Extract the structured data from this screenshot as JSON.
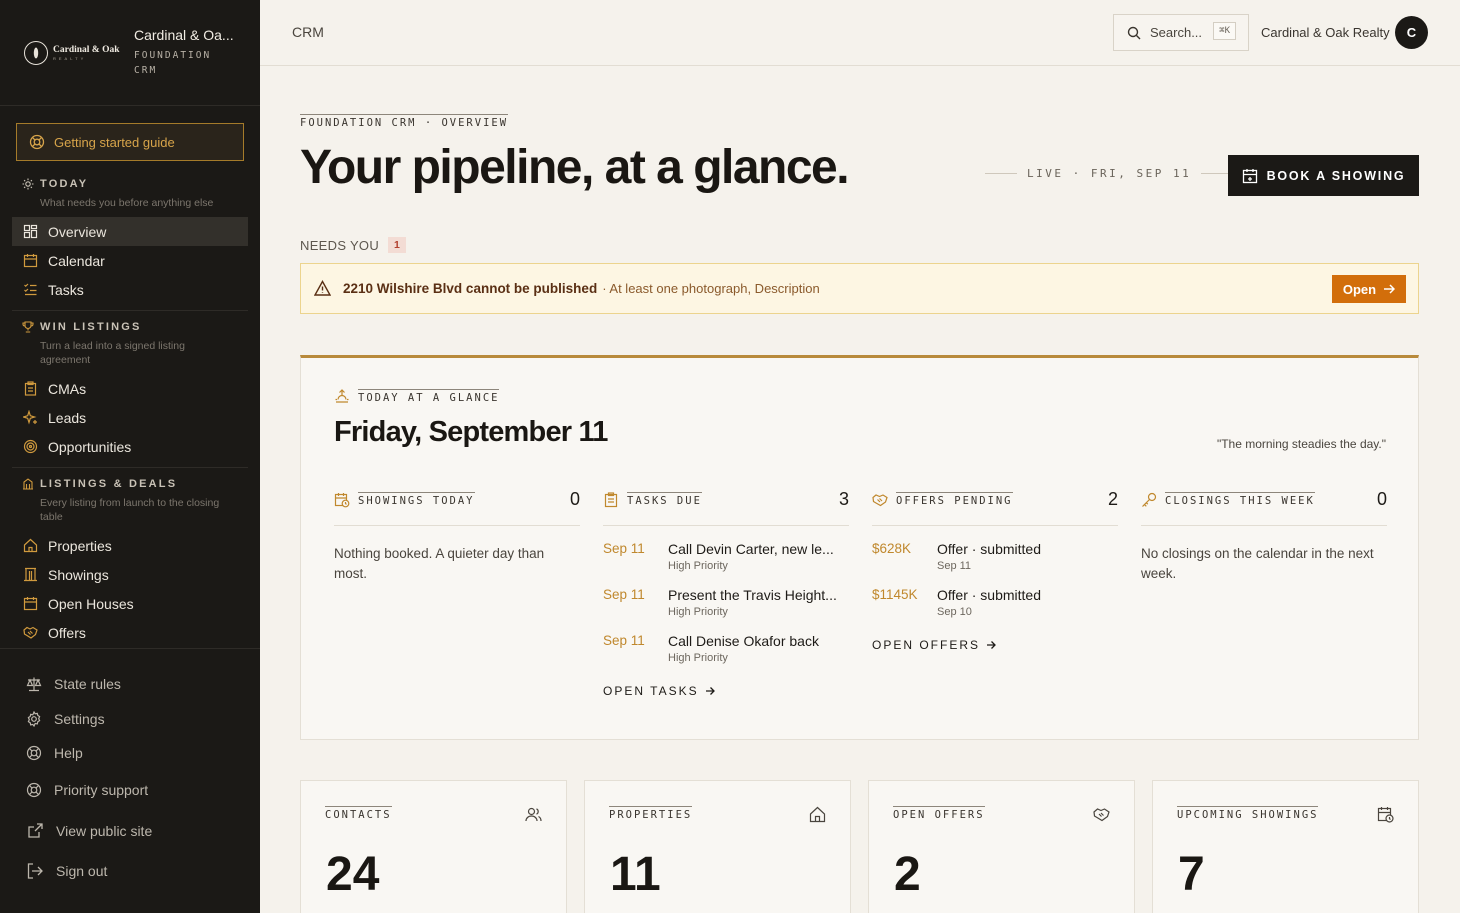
{
  "brand": {
    "logo_text": "Cardinal & Oak",
    "logo_sub": "REALTY",
    "name": "Cardinal & Oa...",
    "sub_line1": "FOUNDATION",
    "sub_line2": "CRM"
  },
  "sidebar": {
    "guide_label": "Getting started guide",
    "sections": [
      {
        "title": "TODAY",
        "desc": "What needs you before anything else",
        "items": [
          {
            "label": "Overview",
            "icon": "overview-icon"
          },
          {
            "label": "Calendar",
            "icon": "calendar-icon"
          },
          {
            "label": "Tasks",
            "icon": "tasks-icon"
          }
        ]
      },
      {
        "title": "WIN LISTINGS",
        "desc": "Turn a lead into a signed listing agreement",
        "items": [
          {
            "label": "CMAs",
            "icon": "clipboard-icon"
          },
          {
            "label": "Leads",
            "icon": "sparkle-icon"
          },
          {
            "label": "Opportunities",
            "icon": "target-icon"
          }
        ]
      },
      {
        "title": "LISTINGS & DEALS",
        "desc": "Every listing from launch to the closing table",
        "items": [
          {
            "label": "Properties",
            "icon": "home-icon"
          },
          {
            "label": "Showings",
            "icon": "building-icon"
          },
          {
            "label": "Open Houses",
            "icon": "calendar-icon"
          },
          {
            "label": "Offers",
            "icon": "handshake-icon"
          }
        ]
      }
    ],
    "bottom": [
      {
        "label": "State rules",
        "icon": "scale-icon"
      },
      {
        "label": "Settings",
        "icon": "gear-icon"
      },
      {
        "label": "Help",
        "icon": "lifebuoy-icon"
      },
      {
        "label": "Priority support",
        "icon": "support-icon"
      },
      {
        "label": "View public site",
        "icon": "external-link-icon"
      },
      {
        "label": "Sign out",
        "icon": "sign-out-icon"
      }
    ]
  },
  "topbar": {
    "crumb": "CRM",
    "search_placeholder": "Search...",
    "search_kbd": "⌘K",
    "account": "Cardinal & Oak Realty",
    "avatar_initial": "C"
  },
  "main": {
    "eyebrow": "FOUNDATION CRM · OVERVIEW",
    "headline": "Your pipeline, at a glance.",
    "live": "LIVE · FRI, SEP 11",
    "book_label": "BOOK A SHOWING",
    "needs_label": "NEEDS YOU",
    "needs_count": "1",
    "alert": {
      "title": "2210 Wilshire Blvd cannot be published",
      "detail": "· At least one photograph, Description",
      "button": "Open"
    }
  },
  "glance": {
    "eyebrow": "TODAY AT A GLANCE",
    "date": "Friday, September 11",
    "quote": "\"The morning steadies the day.\"",
    "showings": {
      "title": "SHOWINGS TODAY",
      "count": "0",
      "empty": "Nothing booked. A quieter day than most."
    },
    "tasks": {
      "title": "TASKS DUE",
      "count": "3",
      "rows": [
        {
          "date": "Sep 11",
          "main": "Call Devin Carter, new le...",
          "sub": "High Priority"
        },
        {
          "date": "Sep 11",
          "main": "Present the Travis Height...",
          "sub": "High Priority"
        },
        {
          "date": "Sep 11",
          "main": "Call Denise Okafor back",
          "sub": "High Priority"
        }
      ],
      "link": "OPEN TASKS"
    },
    "offers": {
      "title": "OFFERS PENDING",
      "count": "2",
      "rows": [
        {
          "date": "$628K",
          "main": "Offer · submitted",
          "sub": "Sep 11"
        },
        {
          "date": "$1145K",
          "main": "Offer · submitted",
          "sub": "Sep 10"
        }
      ],
      "link": "OPEN OFFERS"
    },
    "closings": {
      "title": "CLOSINGS THIS WEEK",
      "count": "0",
      "empty": "No closings on the calendar in the next week."
    }
  },
  "stats": [
    {
      "label": "CONTACTS",
      "value": "24",
      "icon": "users-icon"
    },
    {
      "label": "PROPERTIES",
      "value": "11",
      "icon": "home-icon"
    },
    {
      "label": "OPEN OFFERS",
      "value": "2",
      "icon": "handshake-icon"
    },
    {
      "label": "UPCOMING SHOWINGS",
      "value": "7",
      "icon": "calendar-clock-icon"
    }
  ],
  "colors": {
    "accent": "#b88a3b",
    "alert_button": "#d26e0b",
    "sidebar_bg": "#1b1916",
    "page_bg": "#f5f2ec"
  }
}
